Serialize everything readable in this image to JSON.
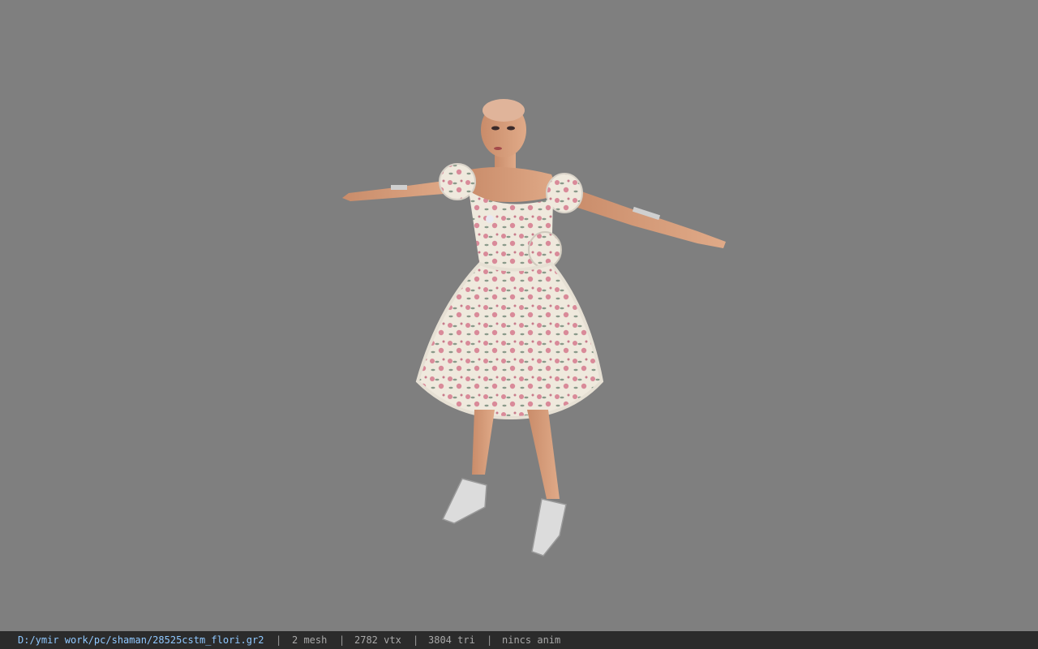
{
  "viewer": {
    "background_color": "#7f7f7f",
    "model_subject": "female character model in floral dress (T-pose)",
    "dress_colors": {
      "base": "#efe9dd",
      "flower": "#d98a99",
      "leaf": "#8a9a8a",
      "skin": "#d9a07e"
    }
  },
  "statusbar": {
    "file_path": "D:/ymir work/pc/shaman/28525cstm_flori.gr2",
    "separator": "|",
    "mesh": "2 mesh",
    "vtx": "2782 vtx",
    "tri": "3804 tri",
    "anim": "nincs anim"
  }
}
